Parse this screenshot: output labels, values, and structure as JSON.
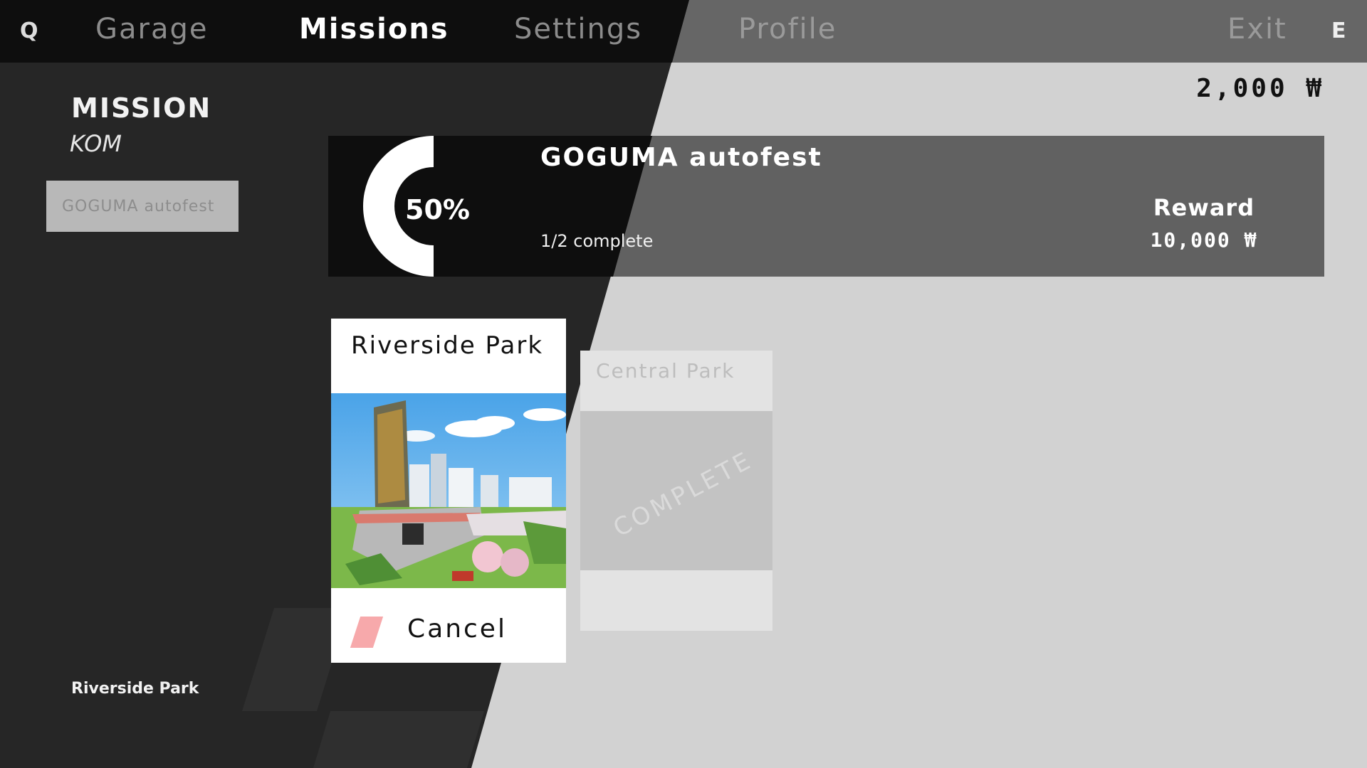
{
  "nav": {
    "left_key": "Q",
    "right_key": "E",
    "tabs": [
      {
        "label": "Garage",
        "active": false
      },
      {
        "label": "Missions",
        "active": true
      },
      {
        "label": "Settings",
        "active": false
      },
      {
        "label": "Profile",
        "active": false
      }
    ],
    "exit_label": "Exit"
  },
  "wallet": {
    "balance": "2,000 ₩"
  },
  "sidebar": {
    "heading": "MISSION",
    "subheading": "KOM",
    "items": [
      {
        "label": "GOGUMA autofest"
      }
    ],
    "current_location": "Riverside Park"
  },
  "mission": {
    "title": "GOGUMA autofest",
    "progress_percent_label": "50%",
    "progress_fraction": 0.5,
    "progress_text": "1/2 complete",
    "reward_label": "Reward",
    "reward_value": "10,000 ₩"
  },
  "locations": [
    {
      "name": "Riverside Park",
      "action_label": "Cancel",
      "status": "active"
    },
    {
      "name": "Central Park",
      "status_label": "COMPLETE",
      "status": "complete"
    }
  ],
  "colors": {
    "accent_cancel": "#f7a9ab",
    "dark_bg": "#262626",
    "light_bg": "#d2d2d2"
  }
}
